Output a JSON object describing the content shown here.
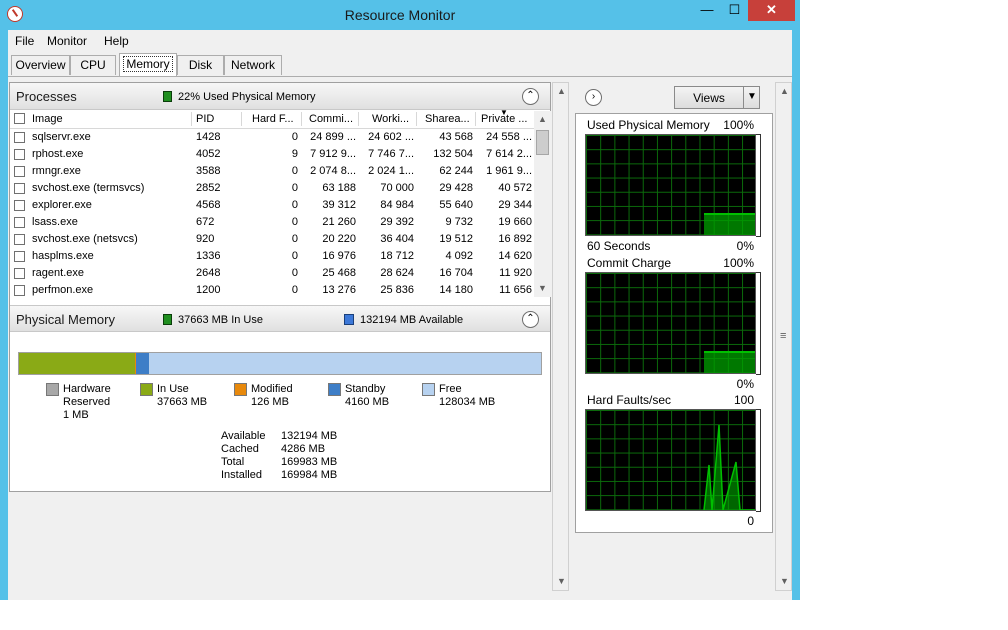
{
  "window": {
    "title": "Resource Monitor",
    "min_label": "—",
    "max_label": "☐",
    "close_label": "✕"
  },
  "menu": [
    "File",
    "Monitor",
    "Help"
  ],
  "tabs": [
    "Overview",
    "CPU",
    "Memory",
    "Disk",
    "Network"
  ],
  "active_tab": "Memory",
  "processes": {
    "title": "Processes",
    "status": "22% Used Physical Memory",
    "columns": [
      "Image",
      "PID",
      "Hard F...",
      "Commi...",
      "Worki...",
      "Sharea...",
      "Private ..."
    ],
    "rows": [
      [
        "sqlservr.exe",
        "1428",
        "0",
        "24 899 ...",
        "24 602 ...",
        "43 568",
        "24 558 ..."
      ],
      [
        "rphost.exe",
        "4052",
        "9",
        "7 912 9...",
        "7 746 7...",
        "132 504",
        "7 614 2..."
      ],
      [
        "rmngr.exe",
        "3588",
        "0",
        "2 074 8...",
        "2 024 1...",
        "62 244",
        "1 961 9..."
      ],
      [
        "svchost.exe (termsvcs)",
        "2852",
        "0",
        "63 188",
        "70 000",
        "29 428",
        "40 572"
      ],
      [
        "explorer.exe",
        "4568",
        "0",
        "39 312",
        "84 984",
        "55 640",
        "29 344"
      ],
      [
        "lsass.exe",
        "672",
        "0",
        "21 260",
        "29 392",
        "9 732",
        "19 660"
      ],
      [
        "svchost.exe (netsvcs)",
        "920",
        "0",
        "20 220",
        "36 404",
        "19 512",
        "16 892"
      ],
      [
        "hasplms.exe",
        "1336",
        "0",
        "16 976",
        "18 712",
        "4 092",
        "14 620"
      ],
      [
        "ragent.exe",
        "2648",
        "0",
        "25 468",
        "28 624",
        "16 704",
        "11 920"
      ],
      [
        "perfmon.exe",
        "1200",
        "0",
        "13 276",
        "25 836",
        "14 180",
        "11 656"
      ]
    ]
  },
  "physical_memory": {
    "title": "Physical Memory",
    "in_use_status": "37663 MB In Use",
    "available_status": "132194 MB Available",
    "bar_fractions": {
      "hardware_reserved": 5.9e-06,
      "in_use": 0.2216,
      "modified": 0.0007,
      "standby": 0.0245,
      "free": 0.7532
    },
    "legend": [
      {
        "name": "Hardware Reserved",
        "line1": "Hardware",
        "line2": "Reserved",
        "line3": "1 MB",
        "color": "#a8a8a8"
      },
      {
        "name": "In Use",
        "line1": "In Use",
        "line2": "37663 MB",
        "line3": "",
        "color": "#8aaa16"
      },
      {
        "name": "Modified",
        "line1": "Modified",
        "line2": "126 MB",
        "line3": "",
        "color": "#e8890c"
      },
      {
        "name": "Standby",
        "line1": "Standby",
        "line2": "4160 MB",
        "line3": "",
        "color": "#3e7ec7"
      },
      {
        "name": "Free",
        "line1": "Free",
        "line2": "128034 MB",
        "line3": "",
        "color": "#b7d2f0"
      }
    ],
    "stats": [
      {
        "label": "Available",
        "value": "132194 MB"
      },
      {
        "label": "Cached",
        "value": "4286 MB"
      },
      {
        "label": "Total",
        "value": "169983 MB"
      },
      {
        "label": "Installed",
        "value": "169984 MB"
      }
    ]
  },
  "right_panel": {
    "views_label": "Views",
    "graphs": [
      {
        "title": "Used Physical Memory",
        "top_value": "100%",
        "left_bottom": "60 Seconds",
        "right_bottom": "0%",
        "level": 0.22
      },
      {
        "title": "Commit Charge",
        "top_value": "100%",
        "left_bottom": "",
        "right_bottom": "0%",
        "level": 0.22
      },
      {
        "title": "Hard Faults/sec",
        "top_value": "100",
        "left_bottom": "",
        "right_bottom": "0",
        "level": 0.0
      }
    ]
  },
  "colors": {
    "accent_green": "#00c000",
    "title_bar": "#55c1e8",
    "close": "#c7403a"
  }
}
